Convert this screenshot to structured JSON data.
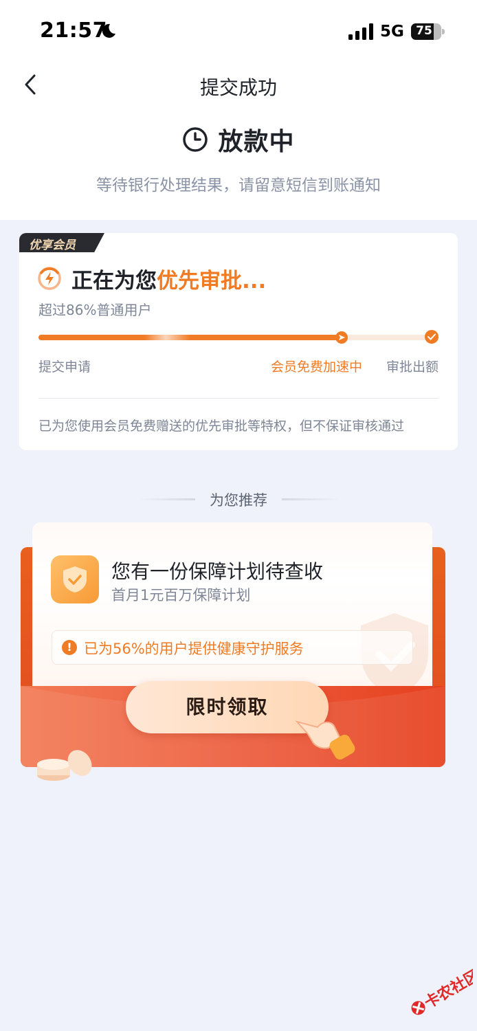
{
  "status_bar": {
    "time": "21:57",
    "network": "5G",
    "battery": "75",
    "battery_level": 0.75
  },
  "nav": {
    "title": "提交成功"
  },
  "hero": {
    "status": "放款中",
    "subtitle": "等待银行处理结果，请留意短信到账通知"
  },
  "member_card": {
    "tag": "优享会员",
    "heading_prefix": "正在为您",
    "heading_highlight": "优先审批...",
    "beat_text": "超过86%普通用户",
    "progress": 0.76,
    "steps": [
      "提交申请",
      "会员免费加速中",
      "审批出额"
    ],
    "note": "已为您使用会员免费赠送的优先审批等特权，但不保证审核通过"
  },
  "recommend": {
    "section_label": "为您推荐",
    "title": "您有一份保障计划待查收",
    "subtitle": "首月1元百万保障计划",
    "info": "已为56%的用户提供健康守护服务",
    "cta": "限时领取"
  },
  "watermark": {
    "text": "卡农社区"
  },
  "colors": {
    "accent": "#f07b25",
    "envelope": "#e6401d",
    "background": "#eff2fa"
  }
}
